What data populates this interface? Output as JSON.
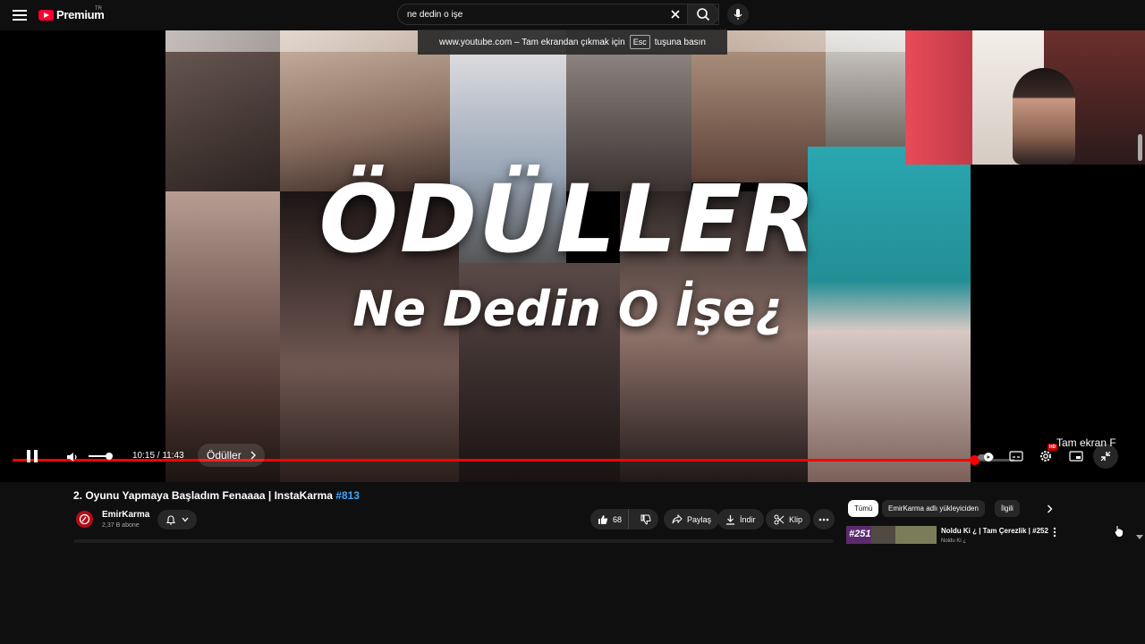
{
  "header": {
    "logo_text": "Premium",
    "country_code": "TR",
    "search": {
      "value": "ne dedin o işe",
      "placeholder": ""
    }
  },
  "toast": {
    "prefix": "www.youtube.com – Tam ekrandan çıkmak için",
    "key": "Esc",
    "suffix": "tuşuna basın"
  },
  "video_overlay": {
    "headline": "ÖDÜLLER",
    "subline": "Ne Dedin O İşe¿"
  },
  "player": {
    "time_current": "10:15",
    "time_total": "11:43",
    "time_display": "10:15 / 11:43",
    "chapter": "Ödüller",
    "progress_fraction": 0.96,
    "buffer_fraction": 1.0,
    "volume_fraction": 0.8,
    "quality_badge": "HD",
    "fullscreen_hint": "Tam ekran (f)",
    "fullscreen_hint_visible": "Tam ekran F"
  },
  "video_info": {
    "title": "2. Oyunu Yapmaya Başladım Fenaaaa | InstaKarma",
    "hashtag": "#813",
    "channel_name": "EmirKarma",
    "subscribers": "2,37 B abone",
    "like_count": "68",
    "share_label": "Paylaş",
    "download_label": "İndir",
    "clip_label": "Klip"
  },
  "related": {
    "chips": [
      "Tümü",
      "EmirKarma adlı yükleyiciden",
      "İlgili"
    ],
    "items": [
      {
        "title": "Noldu Ki ¿ | Tam Çerezlik | #252",
        "channel": "Noldu Ki ¿",
        "thumb_text": "#251"
      }
    ]
  },
  "colors": {
    "accent_red": "#ff0000",
    "link_blue": "#3ea6ff",
    "bg": "#0f0f0f",
    "pill": "#272727"
  }
}
